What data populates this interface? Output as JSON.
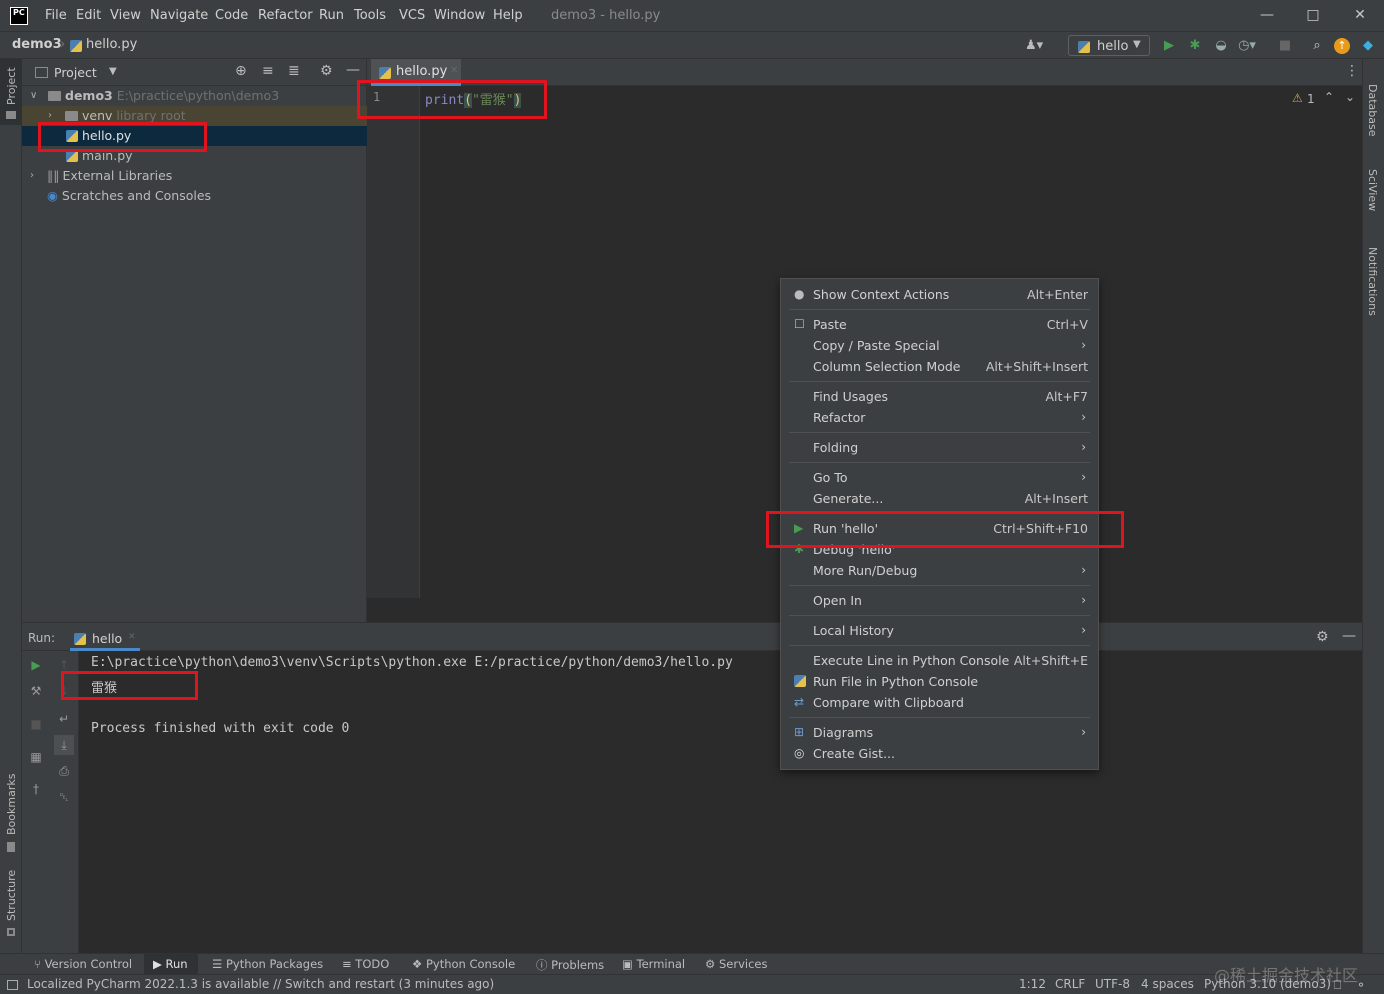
{
  "app": {
    "logo": "PC",
    "menu": [
      "File",
      "Edit",
      "View",
      "Navigate",
      "Code",
      "Refactor",
      "Run",
      "Tools",
      "VCS",
      "Window",
      "Help"
    ],
    "window_title": "demo3 - hello.py"
  },
  "navbar": {
    "project": "demo3",
    "file": "hello.py",
    "run_config": "hello"
  },
  "side_tools": {
    "left_top": "Project",
    "left_bookmarks": "Bookmarks",
    "left_structure": "Structure",
    "right": [
      "Database",
      "SciView",
      "Notifications"
    ]
  },
  "project_panel": {
    "title": "Project",
    "tree": {
      "root_name": "demo3",
      "root_path": "E:\\practice\\python\\demo3",
      "venv_name": "venv",
      "venv_note": "library root",
      "file1": "hello.py",
      "file2": "main.py",
      "ext_libs": "External Libraries",
      "scratches": "Scratches and Consoles"
    }
  },
  "editor": {
    "tab": "hello.py",
    "line_number": "1",
    "code_fn": "print",
    "code_open": "(",
    "code_str": "\"雷猴\"",
    "code_close": ")",
    "inspection": "1"
  },
  "run_panel": {
    "label": "Run:",
    "tab": "hello",
    "lines": {
      "command": "E:\\practice\\python\\demo3\\venv\\Scripts\\python.exe E:/practice/python/demo3/hello.py",
      "output": "雷猴",
      "exit": "Process finished with exit code 0"
    }
  },
  "context_menu": {
    "show_context_actions": {
      "label": "Show Context Actions",
      "shortcut": "Alt+Enter"
    },
    "paste": {
      "label": "Paste",
      "shortcut": "Ctrl+V"
    },
    "copy_paste_special": {
      "label": "Copy / Paste Special"
    },
    "column_selection": {
      "label": "Column Selection Mode",
      "shortcut": "Alt+Shift+Insert"
    },
    "find_usages": {
      "label": "Find Usages",
      "shortcut": "Alt+F7"
    },
    "refactor": {
      "label": "Refactor"
    },
    "folding": {
      "label": "Folding"
    },
    "go_to": {
      "label": "Go To"
    },
    "generate": {
      "label": "Generate...",
      "shortcut": "Alt+Insert"
    },
    "run_hello": {
      "label": "Run 'hello'",
      "shortcut": "Ctrl+Shift+F10"
    },
    "debug_hello": {
      "label": "Debug 'hello'"
    },
    "more_run_debug": {
      "label": "More Run/Debug"
    },
    "open_in": {
      "label": "Open In"
    },
    "local_history": {
      "label": "Local History"
    },
    "execute_line": {
      "label": "Execute Line in Python Console",
      "shortcut": "Alt+Shift+E"
    },
    "run_file_console": {
      "label": "Run File in Python Console"
    },
    "compare_clipboard": {
      "label": "Compare with Clipboard"
    },
    "diagrams": {
      "label": "Diagrams"
    },
    "create_gist": {
      "label": "Create Gist..."
    }
  },
  "bottom_tools": {
    "version_control": "Version Control",
    "run": "Run",
    "python_packages": "Python Packages",
    "todo": "TODO",
    "python_console": "Python Console",
    "problems": "Problems",
    "terminal": "Terminal",
    "services": "Services"
  },
  "status": {
    "message": "Localized PyCharm 2022.1.3 is available // Switch and restart (3 minutes ago)",
    "position": "1:12",
    "line_sep": "CRLF",
    "encoding": "UTF-8",
    "indent": "4 spaces",
    "interpreter": "Python 3.10 (demo3)"
  },
  "watermark": "@稀土掘金技术社区",
  "colors": {
    "accent_green": "#499c54",
    "highlight_red": "#e0141e",
    "selection": "#0d293e",
    "keyword": "#8888c6",
    "string": "#6a8759"
  }
}
